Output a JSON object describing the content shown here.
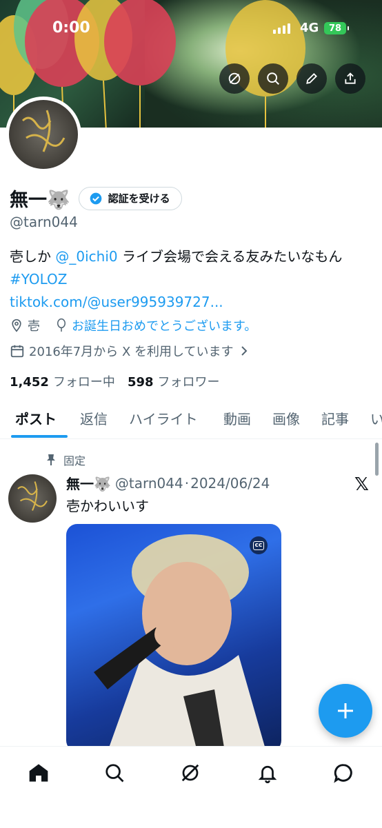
{
  "status_bar": {
    "time": "0:00",
    "network": "4G",
    "battery": "78"
  },
  "profile": {
    "name": "無一🐺",
    "verify_label": "認証を受ける",
    "handle": "@tarn044",
    "bio_text": "壱しか ",
    "bio_mention": "@_0ichi0",
    "bio_text2": " ライブ会場で会える友みたいなもん ",
    "bio_hashtag": "#YOLOZ",
    "link": "tiktok.com/@user995939727...",
    "location": "壱",
    "birthday": "お誕生日おめでとうございます。",
    "joined": "2016年7月から X を利用しています",
    "following_count": "1,452",
    "following_label": "フォロー中",
    "followers_count": "598",
    "followers_label": "フォロワー"
  },
  "tabs": [
    "ポスト",
    "返信",
    "ハイライト",
    "動画",
    "画像",
    "記事",
    "い"
  ],
  "post": {
    "pinned_label": "固定",
    "author_name": "無一🐺",
    "author_handle": "@tarn044",
    "separator": "·",
    "date": "2024/06/24",
    "text": "壱かわいいす",
    "x_logo": "𝕏",
    "cc_label": "cc"
  },
  "fab": {
    "icon": "plus-icon"
  },
  "colors": {
    "accent": "#1d9bf0",
    "text": "#0f1419",
    "secondary": "#536471"
  }
}
